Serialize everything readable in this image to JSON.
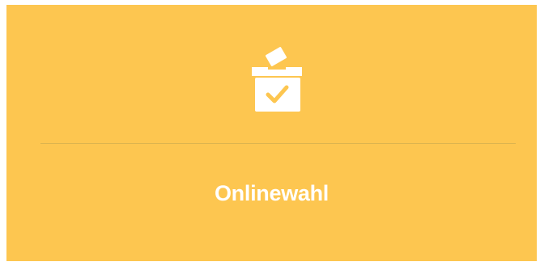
{
  "tile": {
    "label": "Onlinewahl",
    "icon": "ballot-box-check-icon",
    "background_color": "#fdc650",
    "foreground_color": "#ffffff",
    "divider_color": "#dcb44f"
  }
}
